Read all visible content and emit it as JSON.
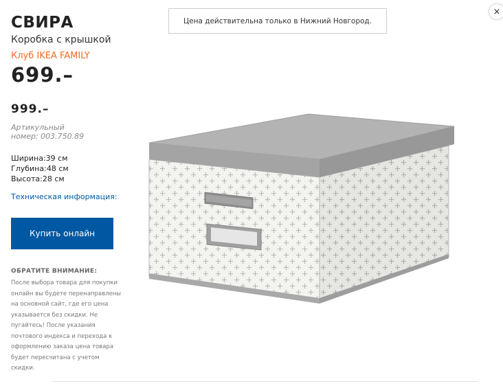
{
  "product": {
    "name": "СВИРА",
    "description": "Коробка с крышкой",
    "family_label": "Клуб IKEA FAMILY",
    "family_price": "699.–",
    "regular_price": "999.–",
    "article_label": "Артикульный",
    "article_number": "номер: 003.750.89",
    "width": "Ширина:39 см",
    "depth": "Глубина:48 см",
    "height": "Высота:28 см",
    "tech_info_link": "Техническая информация:",
    "buy_button": "Купить онлайн"
  },
  "notice": {
    "heading": "ОБРАТИТЕ ВНИМАНИЕ:",
    "lines": [
      "После выбора товара для покупки",
      "онлайн вы будете перенаправлены",
      "на основной сайт, где его цена",
      "указывается без скидки. Не",
      "пугайтесь! После указания",
      "почтового индекса и перехода к",
      "оформлению заказа цена товара",
      "будет пересчитана с учетом",
      "скидки."
    ]
  },
  "city_notice": "Цена действительна только в Нижний Новгород.",
  "close_icon": "×",
  "colors": {
    "brand_blue": "#0058a3",
    "family_orange": "#f26a21",
    "box_grey": "#a9a9a9"
  }
}
